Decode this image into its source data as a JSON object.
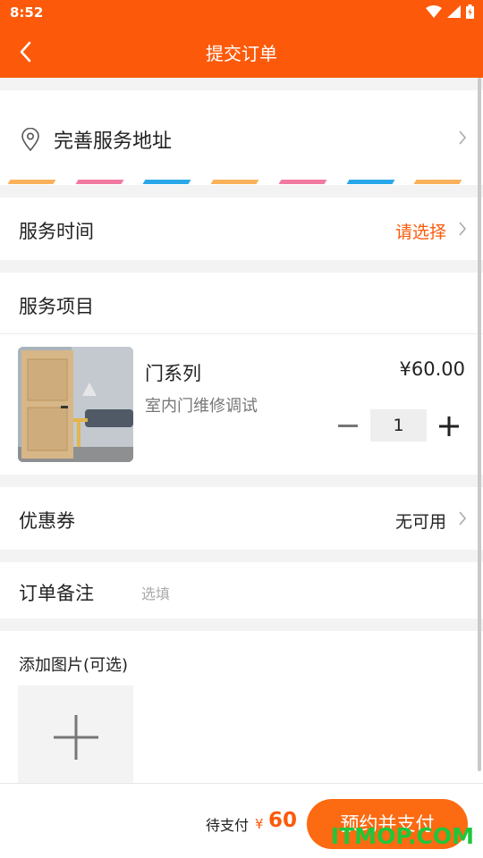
{
  "status_bar": {
    "time": "8:52"
  },
  "header": {
    "title": "提交订单"
  },
  "address": {
    "label": "完善服务地址"
  },
  "service_time": {
    "label": "服务时间",
    "value": "请选择",
    "value_color": "#fc5a0a"
  },
  "project": {
    "label": "服务项目",
    "item": {
      "name": "门系列",
      "description": "室内门维修调试",
      "price": "¥60.00",
      "quantity": "1"
    }
  },
  "coupon": {
    "label": "优惠券",
    "value": "无可用"
  },
  "note": {
    "label": "订单备注",
    "placeholder": "选填"
  },
  "images": {
    "label": "添加图片(可选)"
  },
  "footer": {
    "pay_label": "待支付",
    "currency": "¥",
    "amount": "60",
    "button": "预约并支付"
  },
  "watermark": "ITMOP.COM",
  "colors": {
    "brand": "#fc5a0a",
    "stripe": [
      "#fbb25b",
      "#f27aa0",
      "#29a7e8"
    ]
  }
}
